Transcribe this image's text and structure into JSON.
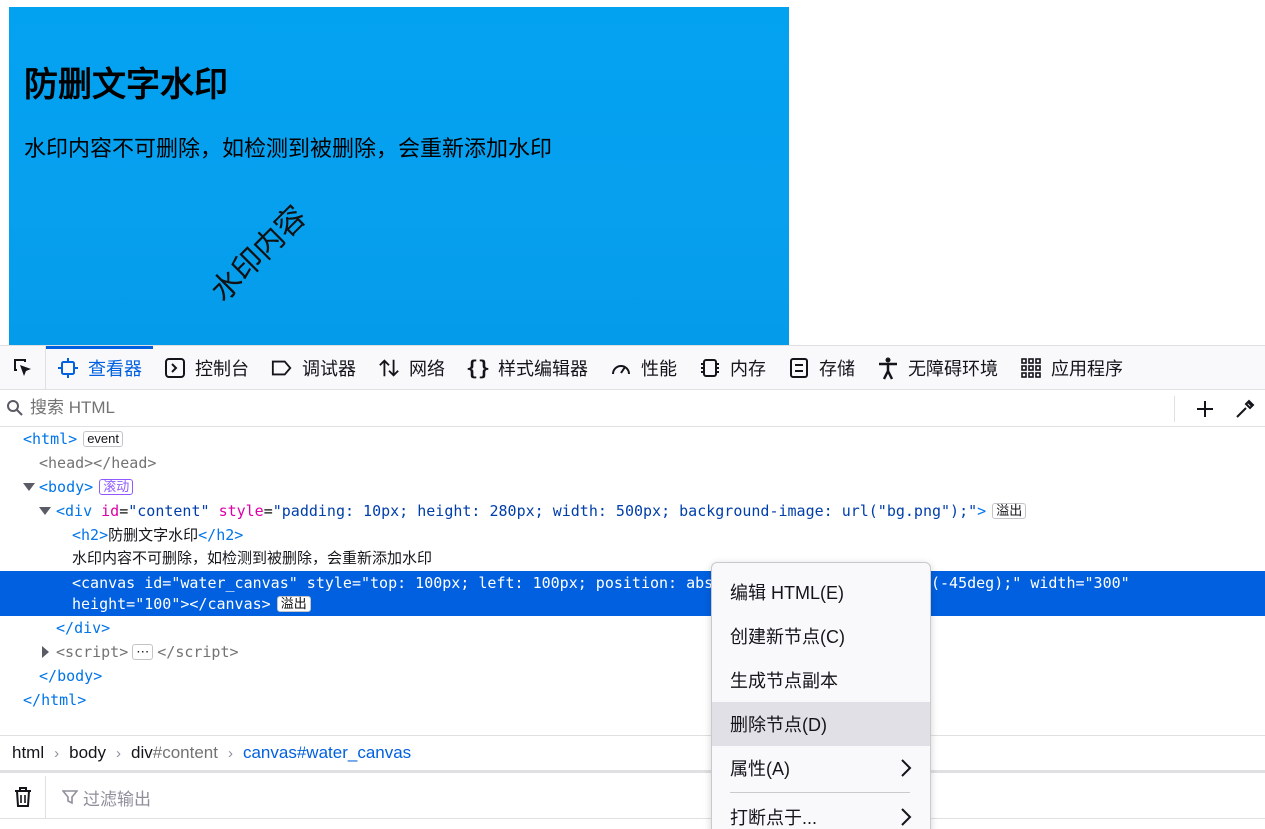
{
  "preview": {
    "heading": "防删文字水印",
    "paragraph": "水印内容不可删除，如检测到被删除，会重新添加水印",
    "watermark": "水印内容"
  },
  "devtools": {
    "tabs": [
      {
        "label": "查看器",
        "icon": "inspector-icon",
        "active": true
      },
      {
        "label": "控制台",
        "icon": "console-icon"
      },
      {
        "label": "调试器",
        "icon": "debugger-icon"
      },
      {
        "label": "网络",
        "icon": "network-icon"
      },
      {
        "label": "样式编辑器",
        "icon": "style-editor-icon"
      },
      {
        "label": "性能",
        "icon": "performance-icon"
      },
      {
        "label": "内存",
        "icon": "memory-icon"
      },
      {
        "label": "存储",
        "icon": "storage-icon"
      },
      {
        "label": "无障碍环境",
        "icon": "accessibility-icon"
      },
      {
        "label": "应用程序",
        "icon": "application-icon"
      }
    ],
    "search_placeholder": "搜索 HTML",
    "tree": {
      "html_open": "html",
      "event_badge": "event",
      "head": "head",
      "body": "body",
      "scroll_badge": "滚动",
      "div": "div",
      "div_id_attr": "id",
      "div_id_val": "\"content\"",
      "div_style_attr": "style",
      "div_style_val": "\"padding: 10px; height: 280px; width: 500px; background-image: url(\"bg.png\");\"",
      "overflow_badge": "溢出",
      "h2": "h2",
      "h2_text": "防删文字水印",
      "div_text": "水印内容不可删除，如检测到被删除，会重新添加水印",
      "canvas_line1": "<canvas id=\"water_canvas\" style=\"top: 100px; left: 100px; position: abs",
      "canvas_line1_tail": "(-45deg);\" width=\"300\"",
      "canvas_line2": "height=\"100\"></canvas>",
      "script": "script",
      "ellipsis_badge": "⋯"
    },
    "breadcrumb": [
      {
        "tag": "html",
        "id": ""
      },
      {
        "tag": "body",
        "id": ""
      },
      {
        "tag": "div",
        "id": "#content"
      },
      {
        "tag": "canvas",
        "id": "#water_canvas"
      }
    ],
    "console_filter_placeholder": "过滤输出"
  },
  "context_menu": {
    "items": [
      {
        "label": "编辑 HTML(E)"
      },
      {
        "label": "创建新节点(C)"
      },
      {
        "label": "生成节点副本"
      },
      {
        "label": "删除节点(D)",
        "hover": true
      },
      {
        "label": "属性(A)",
        "submenu": true
      },
      {
        "label": "打断点于...",
        "submenu": true
      }
    ]
  },
  "colors": {
    "preview_bg": "#03a2f1",
    "accent": "#0061e0",
    "selected_row": "#0060df",
    "attr_name": "#dd00a9",
    "attr_value": "#003eaa",
    "tag": "#0074e8"
  }
}
